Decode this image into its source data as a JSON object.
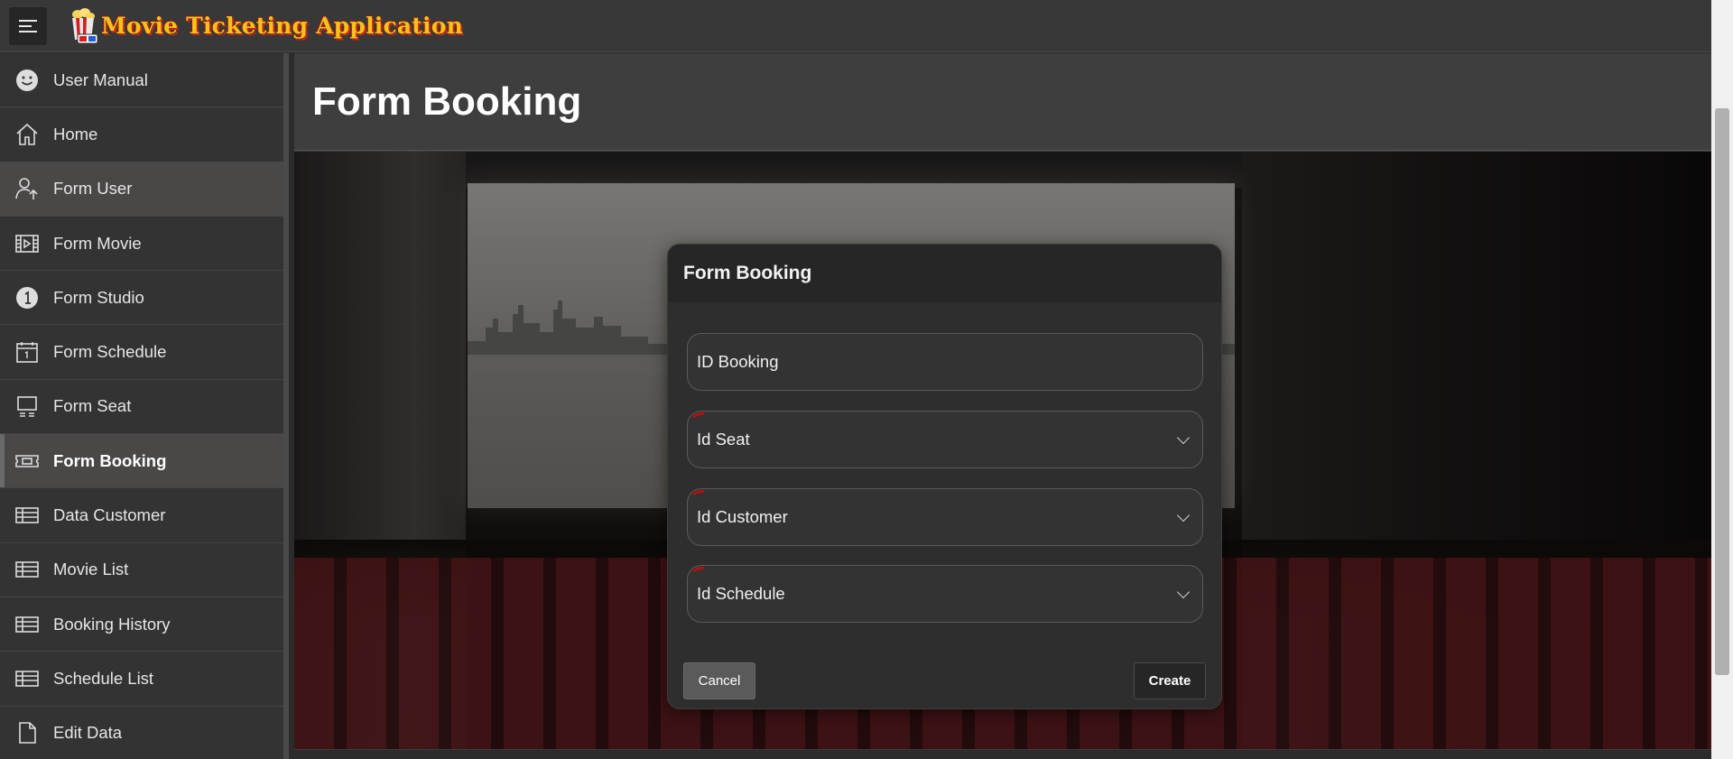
{
  "app": {
    "title": "Movie Ticketing Application"
  },
  "sidebar": {
    "items": [
      {
        "label": "User Manual",
        "icon": "smiley-icon"
      },
      {
        "label": "Home",
        "icon": "home-icon"
      },
      {
        "label": "Form User",
        "icon": "user-upload-icon"
      },
      {
        "label": "Form Movie",
        "icon": "film-icon"
      },
      {
        "label": "Form Studio",
        "icon": "number-one-icon"
      },
      {
        "label": "Form Schedule",
        "icon": "calendar-icon"
      },
      {
        "label": "Form Seat",
        "icon": "monitor-icon"
      },
      {
        "label": "Form Booking",
        "icon": "ticket-icon"
      },
      {
        "label": "Data Customer",
        "icon": "table-icon"
      },
      {
        "label": "Movie List",
        "icon": "table-icon"
      },
      {
        "label": "Booking History",
        "icon": "table-icon"
      },
      {
        "label": "Schedule List",
        "icon": "table-icon"
      },
      {
        "label": "Edit Data",
        "icon": "document-icon"
      }
    ],
    "active_index": 7
  },
  "page": {
    "title": "Form Booking"
  },
  "modal": {
    "title": "Form Booking",
    "fields": {
      "id_booking": {
        "label": "ID Booking"
      },
      "id_seat": {
        "label": "Id Seat"
      },
      "id_customer": {
        "label": "Id Customer"
      },
      "id_schedule": {
        "label": "Id Schedule"
      }
    },
    "cancel_label": "Cancel",
    "create_label": "Create"
  },
  "colors": {
    "required_marker": "#b31010",
    "logo_text": "#f6c21a",
    "logo_shadow": "#c02818"
  }
}
